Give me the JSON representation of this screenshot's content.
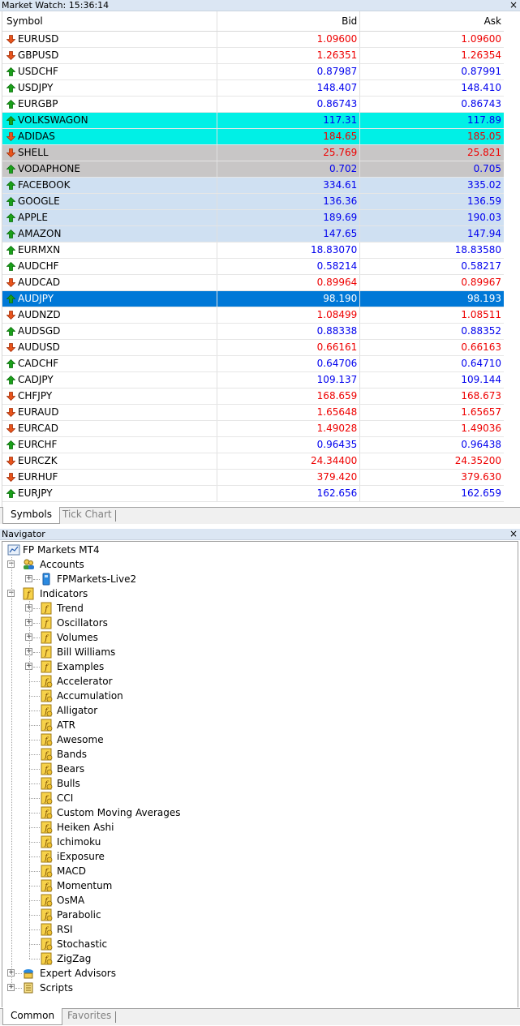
{
  "market_watch": {
    "title": "Market Watch: 15:36:14",
    "close": "×",
    "columns": {
      "symbol": "Symbol",
      "bid": "Bid",
      "ask": "Ask"
    },
    "rows": [
      {
        "symbol": "EURUSD",
        "bid": "1.09600",
        "ask": "1.09600",
        "dir": "down",
        "bg": ""
      },
      {
        "symbol": "GBPUSD",
        "bid": "1.26351",
        "ask": "1.26354",
        "dir": "down",
        "bg": ""
      },
      {
        "symbol": "USDCHF",
        "bid": "0.87987",
        "ask": "0.87991",
        "dir": "up",
        "bg": ""
      },
      {
        "symbol": "USDJPY",
        "bid": "148.407",
        "ask": "148.410",
        "dir": "up",
        "bg": ""
      },
      {
        "symbol": "EURGBP",
        "bid": "0.86743",
        "ask": "0.86743",
        "dir": "up",
        "bg": ""
      },
      {
        "symbol": "VOLKSWAGON",
        "bid": "117.31",
        "ask": "117.89",
        "dir": "up",
        "bg": "cyan"
      },
      {
        "symbol": "ADIDAS",
        "bid": "184.65",
        "ask": "185.05",
        "dir": "down",
        "bg": "cyan"
      },
      {
        "symbol": "SHELL",
        "bid": "25.769",
        "ask": "25.821",
        "dir": "down",
        "bg": "grey"
      },
      {
        "symbol": "VODAPHONE",
        "bid": "0.702",
        "ask": "0.705",
        "dir": "up",
        "bg": "grey"
      },
      {
        "symbol": "FACEBOOK",
        "bid": "334.61",
        "ask": "335.02",
        "dir": "up",
        "bg": "blue"
      },
      {
        "symbol": "GOOGLE",
        "bid": "136.36",
        "ask": "136.59",
        "dir": "up",
        "bg": "blue"
      },
      {
        "symbol": "APPLE",
        "bid": "189.69",
        "ask": "190.03",
        "dir": "up",
        "bg": "blue"
      },
      {
        "symbol": "AMAZON",
        "bid": "147.65",
        "ask": "147.94",
        "dir": "up",
        "bg": "blue"
      },
      {
        "symbol": "EURMXN",
        "bid": "18.83070",
        "ask": "18.83580",
        "dir": "up",
        "bg": ""
      },
      {
        "symbol": "AUDCHF",
        "bid": "0.58214",
        "ask": "0.58217",
        "dir": "up",
        "bg": ""
      },
      {
        "symbol": "AUDCAD",
        "bid": "0.89964",
        "ask": "0.89967",
        "dir": "down",
        "bg": ""
      },
      {
        "symbol": "AUDJPY",
        "bid": "98.190",
        "ask": "98.193",
        "dir": "up",
        "bg": "sel"
      },
      {
        "symbol": "AUDNZD",
        "bid": "1.08499",
        "ask": "1.08511",
        "dir": "down",
        "bg": ""
      },
      {
        "symbol": "AUDSGD",
        "bid": "0.88338",
        "ask": "0.88352",
        "dir": "up",
        "bg": ""
      },
      {
        "symbol": "AUDUSD",
        "bid": "0.66161",
        "ask": "0.66163",
        "dir": "down",
        "bg": ""
      },
      {
        "symbol": "CADCHF",
        "bid": "0.64706",
        "ask": "0.64710",
        "dir": "up",
        "bg": ""
      },
      {
        "symbol": "CADJPY",
        "bid": "109.137",
        "ask": "109.144",
        "dir": "up",
        "bg": ""
      },
      {
        "symbol": "CHFJPY",
        "bid": "168.659",
        "ask": "168.673",
        "dir": "down",
        "bg": ""
      },
      {
        "symbol": "EURAUD",
        "bid": "1.65648",
        "ask": "1.65657",
        "dir": "down",
        "bg": ""
      },
      {
        "symbol": "EURCAD",
        "bid": "1.49028",
        "ask": "1.49036",
        "dir": "down",
        "bg": ""
      },
      {
        "symbol": "EURCHF",
        "bid": "0.96435",
        "ask": "0.96438",
        "dir": "up",
        "bg": ""
      },
      {
        "symbol": "EURCZK",
        "bid": "24.34400",
        "ask": "24.35200",
        "dir": "down",
        "bg": ""
      },
      {
        "symbol": "EURHUF",
        "bid": "379.420",
        "ask": "379.630",
        "dir": "down",
        "bg": ""
      },
      {
        "symbol": "EURJPY",
        "bid": "162.656",
        "ask": "162.659",
        "dir": "up",
        "bg": ""
      }
    ],
    "tabs": [
      "Symbols",
      "Tick Chart"
    ]
  },
  "navigator": {
    "title": "Navigator",
    "close": "×",
    "root": "FP Markets MT4",
    "accounts": {
      "label": "Accounts",
      "items": [
        "FPMarkets-Live2"
      ]
    },
    "indicators": {
      "label": "Indicators",
      "folders": [
        "Trend",
        "Oscillators",
        "Volumes",
        "Bill Williams",
        "Examples"
      ],
      "items": [
        "Accelerator",
        "Accumulation",
        "Alligator",
        "ATR",
        "Awesome",
        "Bands",
        "Bears",
        "Bulls",
        "CCI",
        "Custom Moving Averages",
        "Heiken Ashi",
        "Ichimoku",
        "iExposure",
        "MACD",
        "Momentum",
        "OsMA",
        "Parabolic",
        "RSI",
        "Stochastic",
        "ZigZag"
      ]
    },
    "expert_advisors": "Expert Advisors",
    "scripts": "Scripts",
    "tabs": [
      "Common",
      "Favorites"
    ]
  },
  "colors": {
    "up_arrow": "#1aa01a",
    "down_arrow": "#e8541c",
    "price_up": "#0000ee",
    "price_down": "#ee0000",
    "selected_row": "#0078d7",
    "highlight_cyan": "#00f0e6",
    "highlight_grey": "#c8c6c6",
    "highlight_blue": "#cfe0f2"
  },
  "icons": {
    "up": "green-up-arrow-icon",
    "down": "orange-down-arrow-icon",
    "indicator": "indicator-f-icon",
    "account": "account-icon",
    "expert": "expert-advisor-icon",
    "script": "script-icon",
    "terminal": "terminal-icon"
  }
}
